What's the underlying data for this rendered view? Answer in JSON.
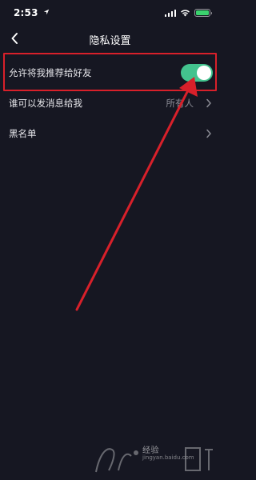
{
  "status_bar": {
    "time": "2:53"
  },
  "nav": {
    "title": "隐私设置"
  },
  "settings": {
    "recommend_to_friends": {
      "label": "允许将我推荐给好友",
      "enabled": true
    },
    "who_can_message": {
      "label": "谁可以发消息给我",
      "value": "所有人"
    },
    "blacklist": {
      "label": "黑名单"
    }
  },
  "colors": {
    "background": "#161722",
    "toggle_on": "#43c38e",
    "annotation_red": "#d8202a"
  },
  "watermark": {
    "text": "经验",
    "url": "jingyan.baidu.com"
  }
}
